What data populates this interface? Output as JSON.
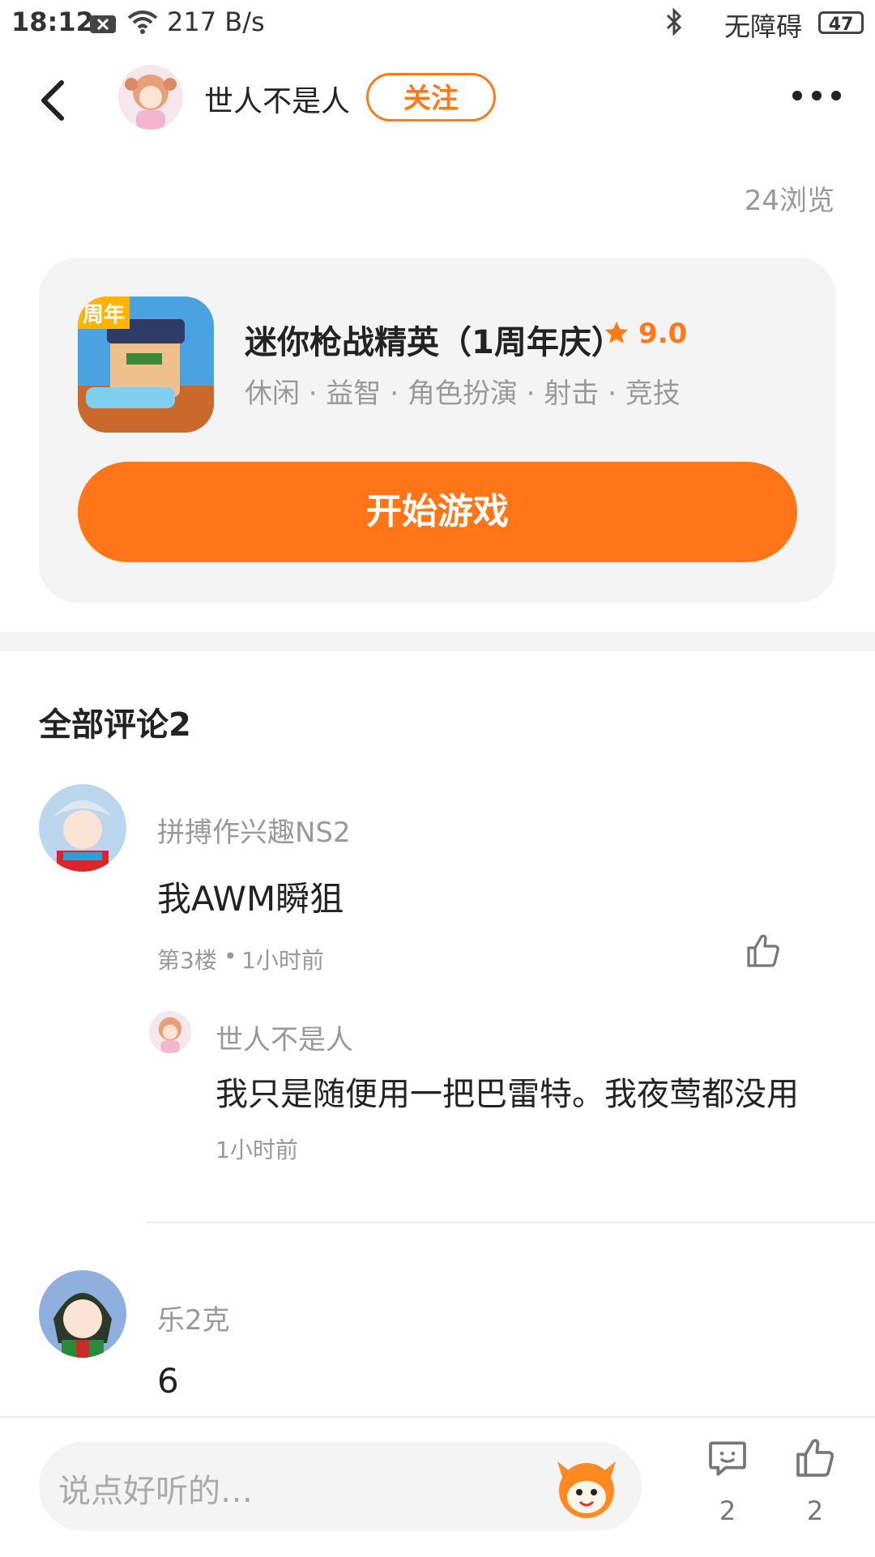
{
  "status_bar": {
    "time": "18:12",
    "net_speed": "217 B/s",
    "accessibility": "无障碍",
    "battery": "47"
  },
  "header": {
    "author": "世人不是人",
    "follow_label": "关注"
  },
  "post": {
    "views": "24浏览"
  },
  "game": {
    "title": "迷你枪战精英（1周年庆）",
    "rating": "9.0",
    "tags": "休闲 · 益智 · 角色扮演 · 射击 · 竞技",
    "badge": "周年",
    "start_label": "开始游戏"
  },
  "comments_header": "全部评论2",
  "comments": [
    {
      "user": "拼搏作兴趣NS2",
      "text": "我AWM瞬狙",
      "floor": "第3楼",
      "time": "1小时前",
      "replies": [
        {
          "user": "世人不是人",
          "text": "我只是随便用一把巴雷特。我夜莺都没用",
          "time": "1小时前"
        }
      ]
    },
    {
      "user": "乐2克",
      "text": "6"
    }
  ],
  "bottom_bar": {
    "placeholder": "说点好听的…",
    "comment_count": "2",
    "like_count": "2"
  },
  "colors": {
    "accent": "#ff7517",
    "text": "#222222",
    "muted": "#999999"
  }
}
